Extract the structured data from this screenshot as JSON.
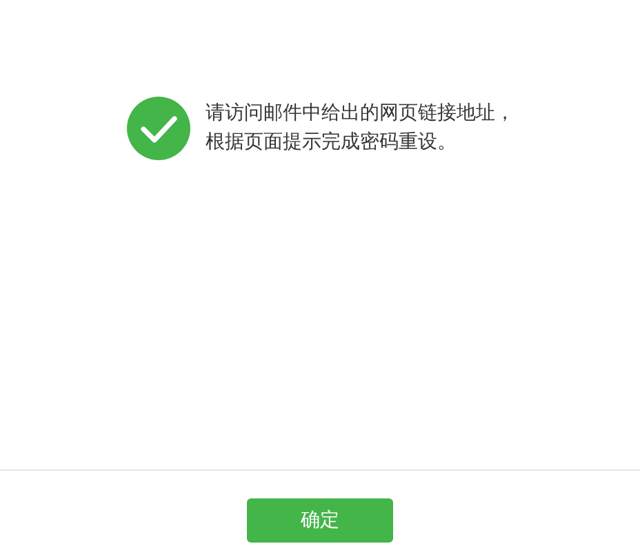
{
  "message": {
    "lines": [
      "请访问邮件中给出的网页链接地址，",
      "根据页面提示完成密码重设。"
    ]
  },
  "buttons": [
    {
      "label": "确定"
    }
  ]
}
